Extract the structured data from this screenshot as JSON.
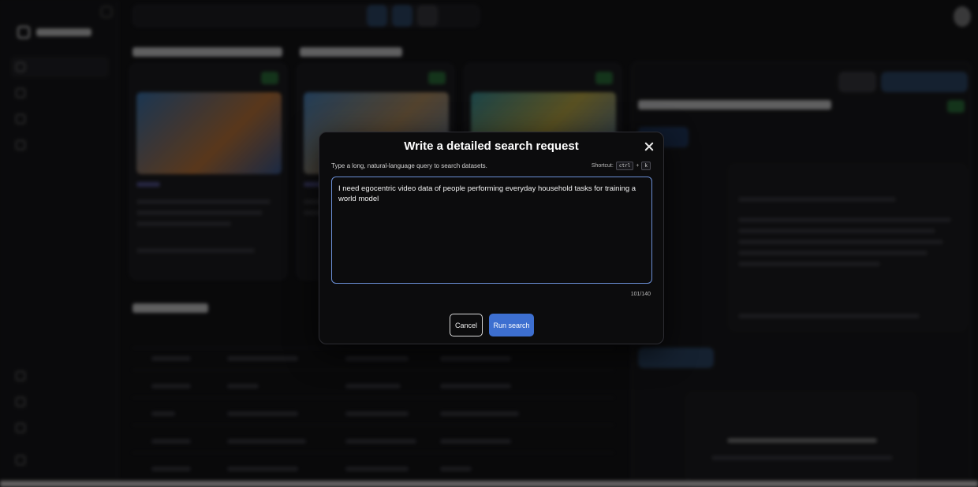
{
  "modal": {
    "title": "Write a detailed search request",
    "hint": "Type a long, natural-language query to search datasets.",
    "shortcut_label": "Shortcut:",
    "shortcut_key1": "ctrl",
    "shortcut_plus": "+",
    "shortcut_key2": "k",
    "query_text": "I need egocentric video data of people performing everyday household tasks for training a world model",
    "counter": "101/140",
    "cancel_label": "Cancel",
    "run_label": "Run search",
    "close_icon": "close-icon",
    "accent_color": "#3d6fd0"
  }
}
